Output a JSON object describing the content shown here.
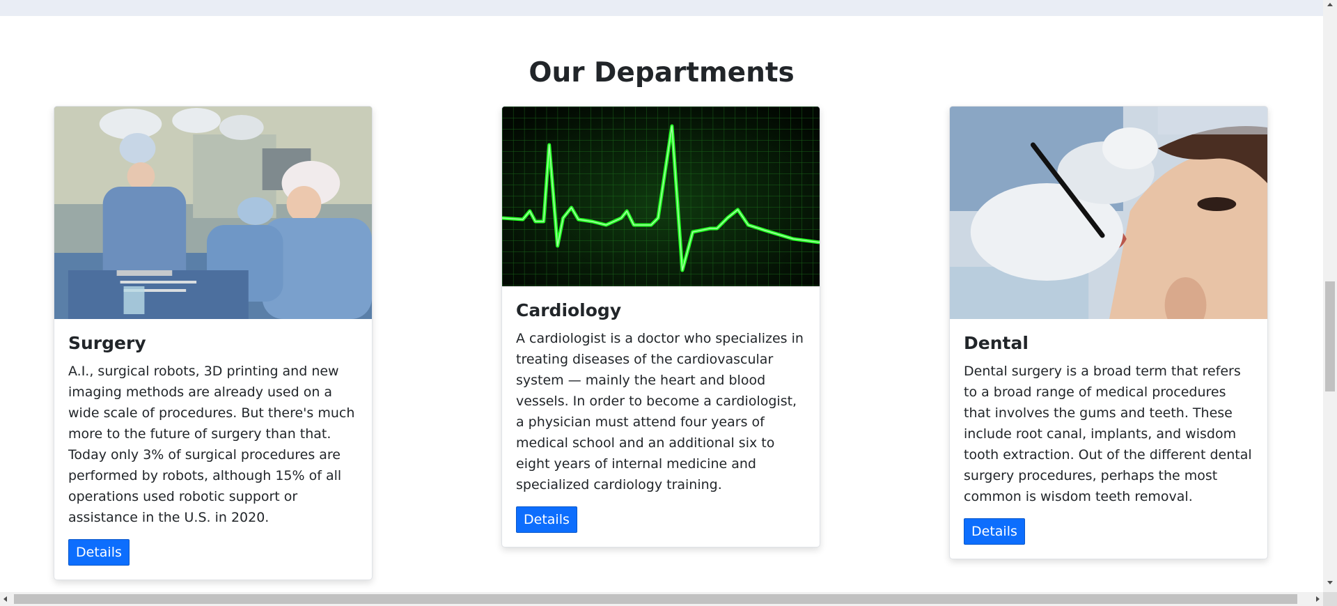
{
  "section": {
    "title": "Our Departments"
  },
  "departments": [
    {
      "title": "Surgery",
      "text": "A.I., surgical robots, 3D printing and new imaging methods are already used on a wide scale of procedures. But there's much more to the future of surgery than that. Today only 3% of surgical procedures are performed by robots, although 15% of all operations used robotic support or assistance in the U.S. in 2020.",
      "button_label": "Details",
      "image": "surgery-photo"
    },
    {
      "title": "Cardiology",
      "text": "A cardiologist is a doctor who specializes in treating diseases of the cardiovascular system — mainly the heart and blood vessels. In order to become a cardiologist, a physician must attend four years of medical school and an additional six to eight years of internal medicine and specialized cardiology training.",
      "button_label": "Details",
      "image": "ecg-heartbeat-photo"
    },
    {
      "title": "Dental",
      "text": "Dental surgery is a broad term that refers to a broad range of medical procedures that involves the gums and teeth. These include root canal, implants, and wisdom tooth extraction. Out of the different dental surgery procedures, perhaps the most common is wisdom teeth removal.",
      "button_label": "Details",
      "image": "dental-procedure-photo"
    }
  ],
  "colors": {
    "primary_button": "#0d6efd",
    "ecg_green": "#22ff22",
    "top_strip": "#e9edf5"
  }
}
